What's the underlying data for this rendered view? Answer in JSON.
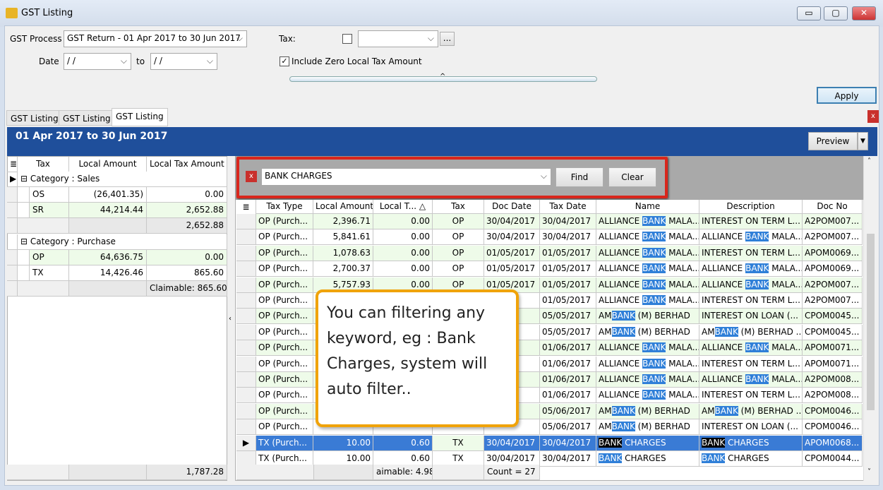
{
  "window": {
    "title": "GST Listing",
    "min": "▭",
    "max": "▢",
    "close": "✕"
  },
  "filters": {
    "gst_process_label": "GST Process",
    "gst_process_value": "GST Return - 01 Apr 2017 to 30 Jun 2017",
    "date_label": "Date",
    "date_from": "/ /",
    "to_label": "to",
    "date_to": "/ /",
    "tax_label": "Tax:",
    "tax_checked": false,
    "tax_value": "",
    "ellipsis": "...",
    "include_zero_label": "Include Zero Local Tax Amount",
    "include_zero_checked": true,
    "apply": "Apply"
  },
  "tabs": [
    "GST Listing",
    "GST Listing",
    "GST Listing"
  ],
  "period": "01 Apr 2017 to 30 Jun 2017",
  "preview": "Preview",
  "summary": {
    "headers": [
      "Tax",
      "Local Amount",
      "Local Tax Amount"
    ],
    "groups": [
      {
        "label": "Category : Sales",
        "rows": [
          [
            "OS",
            "(26,401.35)",
            "0.00"
          ],
          [
            "SR",
            "44,214.44",
            "2,652.88"
          ]
        ],
        "footer": "2,652.88"
      },
      {
        "label": "Category : Purchase",
        "rows": [
          [
            "OP",
            "64,636.75",
            "0.00"
          ],
          [
            "TX",
            "14,426.46",
            "865.60"
          ]
        ],
        "footer": "Claimable: 865.60"
      }
    ],
    "grand_total": "1,787.28"
  },
  "find": {
    "value": "BANK CHARGES",
    "find": "Find",
    "clear": "Clear",
    "highlight": "BANK"
  },
  "grid": {
    "headers": [
      "Tax Type",
      "Local Amount",
      "Local T...",
      "Tax",
      "Doc Date",
      "Tax Date",
      "Name",
      "Description",
      "Doc No"
    ],
    "rows": [
      [
        "OP (Purch...",
        "2,396.71",
        "0.00",
        "OP",
        "30/04/2017",
        "30/04/2017",
        "ALLIANCE BANK MALA...",
        "INTEREST ON TERM L...",
        "A2POM007..."
      ],
      [
        "OP (Purch...",
        "5,841.61",
        "0.00",
        "OP",
        "30/04/2017",
        "30/04/2017",
        "ALLIANCE BANK MALA...",
        "ALLIANCE BANK MALA...",
        "A2POM007..."
      ],
      [
        "OP (Purch...",
        "1,078.63",
        "0.00",
        "OP",
        "01/05/2017",
        "01/05/2017",
        "ALLIANCE BANK MALA...",
        "INTEREST ON TERM L...",
        "APOM0069..."
      ],
      [
        "OP (Purch...",
        "2,700.37",
        "0.00",
        "OP",
        "01/05/2017",
        "01/05/2017",
        "ALLIANCE BANK MALA...",
        "ALLIANCE BANK MALA...",
        "APOM0069..."
      ],
      [
        "OP (Purch...",
        "5,757.93",
        "0.00",
        "OP",
        "01/05/2017",
        "01/05/2017",
        "ALLIANCE BANK MALA...",
        "ALLIANCE BANK MALA...",
        "A2POM007..."
      ],
      [
        "OP (Purch...",
        "",
        "",
        "",
        "",
        "01/05/2017",
        "ALLIANCE BANK MALA...",
        "INTEREST ON TERM L...",
        "A2POM007..."
      ],
      [
        "OP (Purch...",
        "",
        "",
        "",
        "",
        "05/05/2017",
        "AMBANK (M) BERHAD",
        "INTEREST ON LOAN (...",
        "CPOM0045..."
      ],
      [
        "OP (Purch...",
        "",
        "",
        "",
        "",
        "05/05/2017",
        "AMBANK (M) BERHAD",
        "AMBANK (M) BERHAD ...",
        "CPOM0045..."
      ],
      [
        "OP (Purch...",
        "",
        "",
        "",
        "",
        "01/06/2017",
        "ALLIANCE BANK MALA...",
        "ALLIANCE BANK MALA...",
        "APOM0071..."
      ],
      [
        "OP (Purch...",
        "",
        "",
        "",
        "",
        "01/06/2017",
        "ALLIANCE BANK MALA...",
        "INTEREST ON TERM L...",
        "APOM0071..."
      ],
      [
        "OP (Purch...",
        "",
        "",
        "",
        "",
        "01/06/2017",
        "ALLIANCE BANK MALA...",
        "ALLIANCE BANK MALA...",
        "A2POM008..."
      ],
      [
        "OP (Purch...",
        "",
        "",
        "",
        "",
        "01/06/2017",
        "ALLIANCE BANK MALA...",
        "INTEREST ON TERM L...",
        "A2POM008..."
      ],
      [
        "OP (Purch...",
        "",
        "",
        "",
        "",
        "05/06/2017",
        "AMBANK (M) BERHAD",
        "AMBANK (M) BERHAD ...",
        "CPOM0046..."
      ],
      [
        "OP (Purch...",
        "",
        "",
        "",
        "",
        "05/06/2017",
        "AMBANK (M) BERHAD",
        "INTEREST ON LOAN (...",
        "CPOM0046..."
      ],
      [
        "TX (Purch...",
        "10.00",
        "0.60",
        "TX",
        "30/04/2017",
        "30/04/2017",
        "BANK CHARGES",
        "BANK CHARGES",
        "APOM0068..."
      ],
      [
        "TX (Purch...",
        "10.00",
        "0.60",
        "TX",
        "30/04/2017",
        "30/04/2017",
        "BANK CHARGES",
        "BANK CHARGES",
        "CPOM0044..."
      ]
    ],
    "selected_row": 14,
    "footer_claimable": "aimable: 4.98",
    "footer_count": "Count = 27"
  },
  "callout": "You can filtering any keyword, eg : Bank Charges, system will auto filter..",
  "colors": {
    "header_blue": "#1f4f9b",
    "highlight": "#2f7fd8",
    "row_alt": "#eefbe9",
    "selected": "#3a7bd5",
    "callout_border": "#f0a30a",
    "find_border": "#d9261c"
  }
}
